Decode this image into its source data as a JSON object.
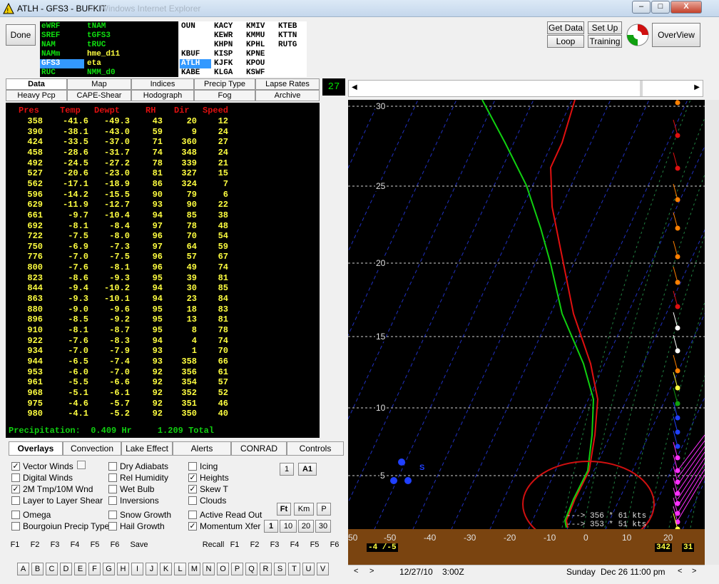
{
  "window": {
    "title": "ATLH - GFS3 - BUFKIT",
    "ghost_title": "... - Windows Internet Explorer",
    "minimize": "–",
    "maximize": "□",
    "close": "X"
  },
  "toolbar": {
    "done": "Done",
    "get_data": "Get Data",
    "set_up": "Set Up",
    "loop": "Loop",
    "training": "Training",
    "overview": "OverView",
    "counter": "27"
  },
  "models": [
    {
      "name": "eWRF",
      "alt": "tNAM"
    },
    {
      "name": "SREF",
      "alt": "tGFS3"
    },
    {
      "name": "NAM",
      "alt": "tRUC"
    },
    {
      "name": "NAMm",
      "alt": "hme_d11"
    },
    {
      "name": "GFS3",
      "alt": "eta"
    },
    {
      "name": "RUC",
      "alt": "NMM_d0"
    }
  ],
  "stations": {
    "row1": [
      "OUN",
      "KACY",
      "KMIV",
      "KTEB"
    ],
    "row2": [
      "KEWR",
      "KMMU",
      "KTTN"
    ],
    "row3": [
      "KHPN",
      "KPHL",
      "RUTG"
    ],
    "row4": [
      "KBUF",
      "KISP",
      "KPNE"
    ],
    "row5": [
      "ATLH",
      "KJFK",
      "KPOU"
    ],
    "row6": [
      "KABE",
      "KLGA",
      "KSWF"
    ]
  },
  "tabs": {
    "row1": [
      "Data",
      "Map",
      "Indices",
      "Precip Type",
      "Lapse Rates"
    ],
    "row2": [
      "Heavy Pcp",
      "CAPE-Shear",
      "Hodograph",
      "Fog",
      "Archive"
    ]
  },
  "table": {
    "headers": [
      "Pres",
      "Temp",
      "Dewpt",
      "RH",
      "Dir",
      "Speed"
    ],
    "rows": [
      [
        "358",
        "-41.6",
        "-49.3",
        "43",
        "20",
        "12"
      ],
      [
        "390",
        "-38.1",
        "-43.0",
        "59",
        "9",
        "24"
      ],
      [
        "424",
        "-33.5",
        "-37.0",
        "71",
        "360",
        "27"
      ],
      [
        "458",
        "-28.6",
        "-31.7",
        "74",
        "348",
        "24"
      ],
      [
        "492",
        "-24.5",
        "-27.2",
        "78",
        "339",
        "21"
      ],
      [
        "527",
        "-20.6",
        "-23.0",
        "81",
        "327",
        "15"
      ],
      [
        "562",
        "-17.1",
        "-18.9",
        "86",
        "324",
        "7"
      ],
      [
        "596",
        "-14.2",
        "-15.5",
        "90",
        "79",
        "6"
      ],
      [
        "629",
        "-11.9",
        "-12.7",
        "93",
        "90",
        "22"
      ],
      [
        "661",
        "-9.7",
        "-10.4",
        "94",
        "85",
        "38"
      ],
      [
        "692",
        "-8.1",
        "-8.4",
        "97",
        "78",
        "48"
      ],
      [
        "722",
        "-7.5",
        "-8.0",
        "96",
        "70",
        "54"
      ],
      [
        "750",
        "-6.9",
        "-7.3",
        "97",
        "64",
        "59"
      ],
      [
        "776",
        "-7.0",
        "-7.5",
        "96",
        "57",
        "67"
      ],
      [
        "800",
        "-7.6",
        "-8.1",
        "96",
        "49",
        "74"
      ],
      [
        "823",
        "-8.6",
        "-9.3",
        "95",
        "39",
        "81"
      ],
      [
        "844",
        "-9.4",
        "-10.2",
        "94",
        "30",
        "85"
      ],
      [
        "863",
        "-9.3",
        "-10.1",
        "94",
        "23",
        "84"
      ],
      [
        "880",
        "-9.0",
        "-9.6",
        "95",
        "18",
        "83"
      ],
      [
        "896",
        "-8.5",
        "-9.2",
        "95",
        "13",
        "81"
      ],
      [
        "910",
        "-8.1",
        "-8.7",
        "95",
        "8",
        "78"
      ],
      [
        "922",
        "-7.6",
        "-8.3",
        "94",
        "4",
        "74"
      ],
      [
        "934",
        "-7.0",
        "-7.9",
        "93",
        "1",
        "70"
      ],
      [
        "944",
        "-6.5",
        "-7.4",
        "93",
        "358",
        "66"
      ],
      [
        "953",
        "-6.0",
        "-7.0",
        "92",
        "356",
        "61"
      ],
      [
        "961",
        "-5.5",
        "-6.6",
        "92",
        "354",
        "57"
      ],
      [
        "968",
        "-5.1",
        "-6.1",
        "92",
        "352",
        "52"
      ],
      [
        "975",
        "-4.6",
        "-5.7",
        "92",
        "351",
        "46"
      ],
      [
        "980",
        "-4.1",
        "-5.2",
        "92",
        "350",
        "40"
      ]
    ],
    "precip_label": "Precipitation:",
    "precip_hr": "0.409 Hr",
    "precip_total": "1.209 Total"
  },
  "overlay_tabs": [
    "Overlays",
    "Convection",
    "Lake Effect",
    "Alerts",
    "CONRAD",
    "Controls"
  ],
  "overlays": {
    "col1": [
      {
        "label": "Vector Winds",
        "checked": true
      },
      {
        "label": "Digital Winds",
        "checked": false
      },
      {
        "label": "2M Tmp/10M Wnd",
        "checked": true
      },
      {
        "label": "Layer to Layer Shear",
        "checked": false
      },
      {
        "label": "Omega",
        "checked": false
      },
      {
        "label": "Bourgoiun Precip Type",
        "checked": false
      }
    ],
    "col2": [
      {
        "label": "Dry Adiabats",
        "checked": false
      },
      {
        "label": "Rel Humidity",
        "checked": false
      },
      {
        "label": "Wet Bulb",
        "checked": false
      },
      {
        "label": "Inversions",
        "checked": false
      },
      {
        "label": "Snow Growth",
        "checked": false
      },
      {
        "label": "Hail Growth",
        "checked": false
      }
    ],
    "col3": [
      {
        "label": "Icing",
        "checked": false
      },
      {
        "label": "Heights",
        "checked": true
      },
      {
        "label": "Skew T",
        "checked": true
      },
      {
        "label": "Clouds",
        "checked": false
      },
      {
        "label": "Active Read Out",
        "checked": false
      },
      {
        "label": "Momentum Xfer",
        "checked": true
      }
    ]
  },
  "small_buttons": {
    "one": "1",
    "a1": "A1",
    "ft": "Ft",
    "km": "Km",
    "p": "P",
    "steps": [
      "1",
      "10",
      "20",
      "30"
    ]
  },
  "fkeys_left": [
    "F1",
    "F2",
    "F3",
    "F4",
    "F5",
    "F6"
  ],
  "save": "Save",
  "recall": "Recall",
  "fkeys_right": [
    "F1",
    "F2",
    "F3",
    "F4",
    "F5",
    "F6"
  ],
  "letters": [
    "A",
    "B",
    "C",
    "D",
    "E",
    "F",
    "G",
    "H",
    "I",
    "J",
    "K",
    "L",
    "M",
    "N",
    "O",
    "P",
    "Q",
    "R",
    "S",
    "T",
    "U",
    "V"
  ],
  "chart": {
    "y_ticks": [
      "30",
      "25",
      "20",
      "15",
      "10",
      "5"
    ],
    "x_ticks": [
      "50",
      "-50",
      "-40",
      "-30",
      "-20",
      "-10",
      "0",
      "10",
      "20"
    ],
    "surface_label": "-4 /-5",
    "readout1": "---> 356 * 61 kts",
    "readout2": "---> 353 * 51 kts",
    "bottom_right1": "342",
    "bottom_right2": "31",
    "s_label": "S",
    "colors": {
      "temp": "#e01010",
      "dewpt": "#10d010",
      "ground": "#7a4410",
      "circle": "#d01010"
    }
  },
  "status": {
    "date": "12/27/10",
    "time": "3:00Z",
    "day": "Sunday",
    "local": "Dec 26 11:00 pm"
  }
}
